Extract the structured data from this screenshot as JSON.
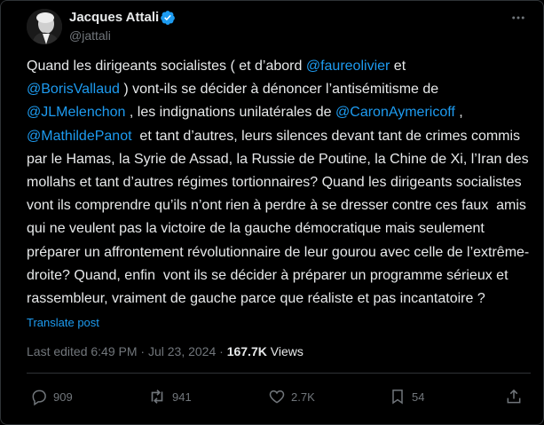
{
  "author": {
    "name": "Jacques Attali",
    "handle": "@jattali"
  },
  "post": {
    "segments": [
      {
        "text": "Quand les dirigeants socialistes ( et d’abord ",
        "type": "text"
      },
      {
        "text": "@faureolivier",
        "type": "mention"
      },
      {
        "text": " et \n",
        "type": "text"
      },
      {
        "text": "@BorisVallaud",
        "type": "mention"
      },
      {
        "text": " ) vont-ils se décider à dénoncer l’antisémitisme de \n",
        "type": "text"
      },
      {
        "text": "@JLMelenchon",
        "type": "mention"
      },
      {
        "text": " , les indignations unilatérales de ",
        "type": "text"
      },
      {
        "text": "@CaronAymericoff",
        "type": "mention"
      },
      {
        "text": " , \n",
        "type": "text"
      },
      {
        "text": "@MathildePanot",
        "type": "mention"
      },
      {
        "text": "  et tant d’autres, leurs silences devant tant de crimes commis par le Hamas, la Syrie de Assad, la Russie de Poutine, la Chine de Xi, l’Iran des mollahs et tant d’autres régimes tortionnaires? Quand les dirigeants socialistes vont ils comprendre qu’ils n’ont rien à perdre à se dresser contre ces faux  amis qui ne veulent pas la victoire de la gauche démocratique mais seulement préparer un affrontement révolutionnaire de leur gourou avec celle de l’extrême-droite? Quand, enfin  vont ils se décider à préparer un programme sérieux et rassembleur, vraiment de gauche parce que réaliste et pas incantatoire ?",
        "type": "text"
      }
    ],
    "translate_label": "Translate post",
    "timestamp": "Last edited 6:49 PM · Jul 23, 2024 · ",
    "views_count": "167.7K",
    "views_label": " Views"
  },
  "actions": {
    "replies": "909",
    "reposts": "941",
    "likes": "2.7K",
    "bookmarks": "54"
  },
  "colors": {
    "background": "#000000",
    "text": "#e7e9ea",
    "secondary": "#71767b",
    "accent": "#1d9bf0",
    "divider": "#2f3336"
  },
  "icons": {
    "verified": "verified-badge-icon",
    "more": "more-options-icon",
    "reply": "reply-icon",
    "repost": "repost-icon",
    "like": "heart-icon",
    "bookmark": "bookmark-icon",
    "share": "share-icon"
  }
}
